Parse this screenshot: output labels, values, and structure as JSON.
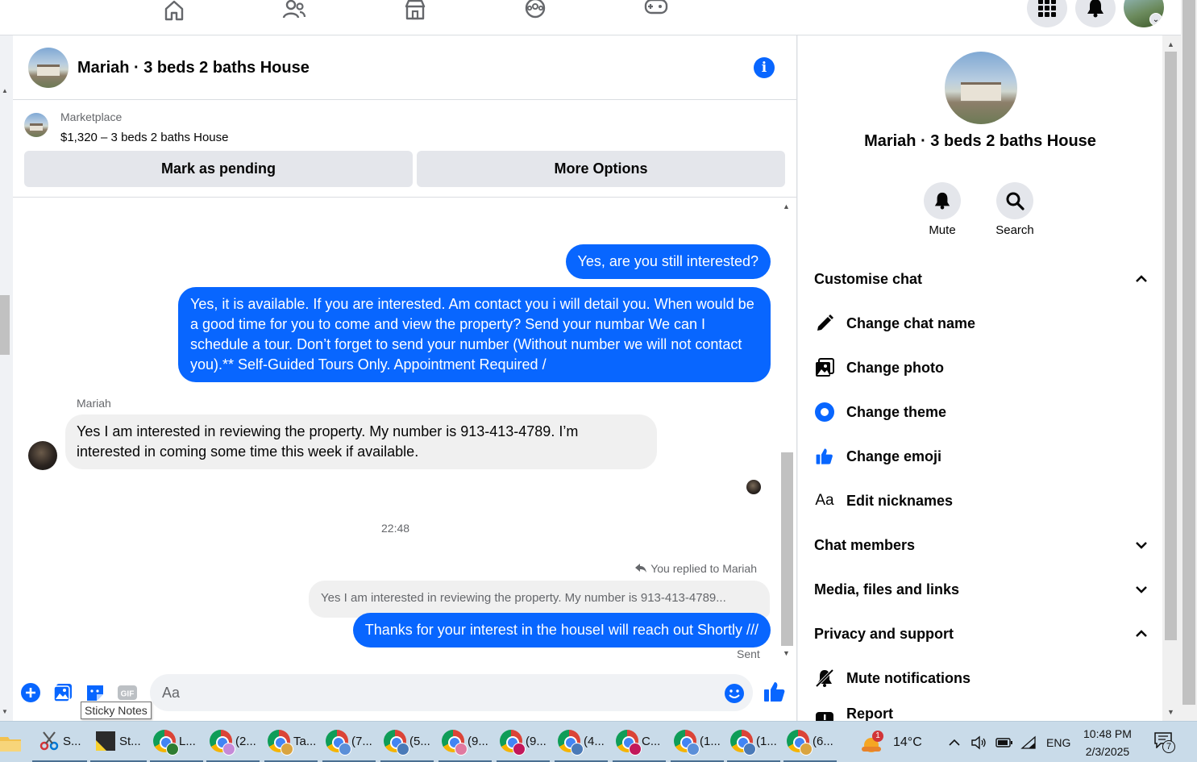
{
  "chat": {
    "title": "Mariah · 3 beds 2 baths House",
    "marketplace": {
      "label": "Marketplace",
      "listing": "$1,320 – 3 beds 2 baths House",
      "btn_pending": "Mark as pending",
      "btn_more": "More Options"
    },
    "messages": {
      "out1": "Yes, are you still interested?",
      "out2": "Yes, it is available. If you are interested.  Am contact you i will detail you.  When would be a good time for you to come and view the property? Send your numbar We can I schedule a tour.  Don’t forget to send your number (Without number we will not contact you).** Self-Guided Tours Only. Appointment Required /",
      "sender": "Mariah",
      "in1": "Yes I am interested in reviewing the property. My number is 913-413-4789. I’m interested in coming some time this week if available.",
      "time": "22:48",
      "replied_to": "You replied to Mariah",
      "quote": "Yes I am interested in reviewing the property. My number is 913-413-4789...",
      "out3": "Thanks for your interest in the houseI will reach out Shortly ///",
      "status": "Sent"
    },
    "composer": {
      "placeholder": "Aa",
      "tooltip": "Sticky Notes",
      "gif_label": "GIF"
    }
  },
  "info": {
    "title": "Mariah · 3 beds 2 baths House",
    "mute": "Mute",
    "search": "Search",
    "customise": "Customise chat",
    "change_name": "Change chat name",
    "change_photo": "Change photo",
    "change_theme": "Change theme",
    "change_emoji": "Change emoji",
    "aa_icon": "Aa",
    "edit_nicknames": "Edit nicknames",
    "members": "Chat members",
    "media": "Media, files and links",
    "privacy": "Privacy and support",
    "mute_notif": "Mute notifications",
    "report": "Report"
  },
  "taskbar": {
    "items": [
      "S...",
      "St...",
      "L...",
      "(2...",
      "Ta...",
      "(7...",
      "(5...",
      "(9...",
      "(9...",
      "(4...",
      "C...",
      "(1...",
      "(1...",
      "(6..."
    ],
    "weather_badge": "1",
    "temp": "14°C",
    "lang": "ENG",
    "time": "10:48 PM",
    "date": "2/3/2025",
    "notif_count": "7"
  },
  "colors": {
    "accent": "#0866ff",
    "bubble_in": "#f0f0f0",
    "button_gray": "#e4e6eb",
    "taskbar": "#c9dbe9"
  }
}
